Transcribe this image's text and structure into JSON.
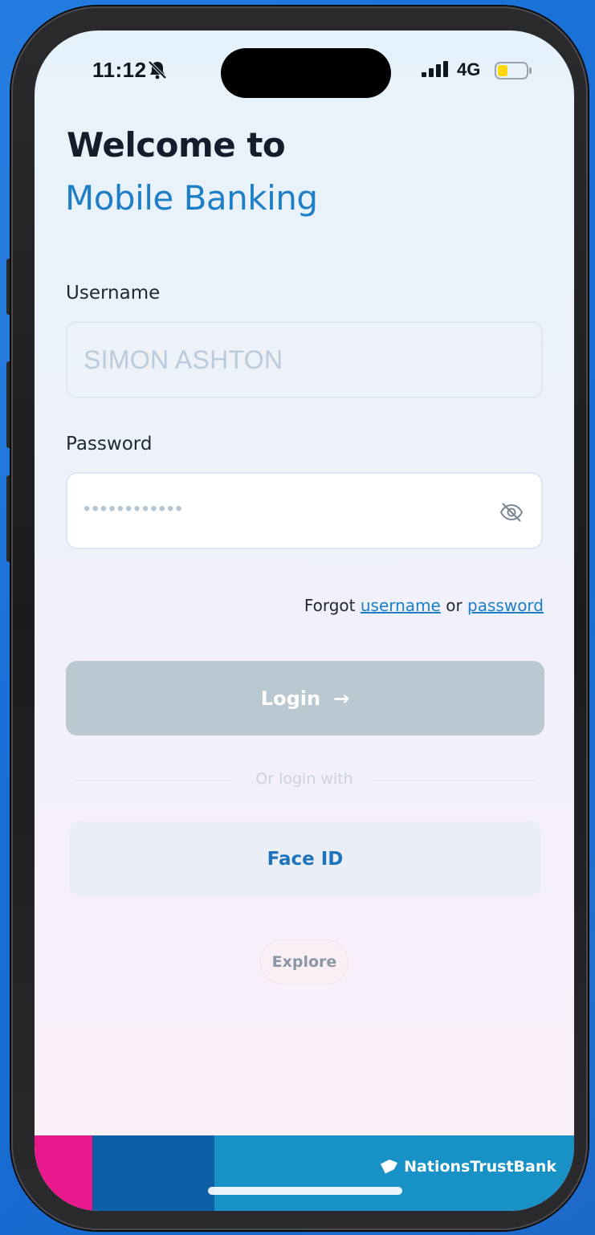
{
  "status_bar": {
    "time": "11:12",
    "network": "4G",
    "battery_color": "#ffd60a"
  },
  "header": {
    "welcome_text": "Welcome to",
    "app_name": "Mobile Banking"
  },
  "form": {
    "username_label": "Username",
    "username_value": "SIMON ASHTON",
    "password_label": "Password",
    "password_masked": "••••••••••••",
    "forgot_prefix": "Forgot",
    "forgot_username": "username",
    "forgot_or": "or",
    "forgot_password": "password"
  },
  "actions": {
    "login_label": "Login",
    "login_arrow": "→",
    "divider_text": "Or login with",
    "face_id_label": "Face ID",
    "explore_label": "Explore"
  },
  "brand": {
    "bank_name": "NationsTrustBank",
    "colors": {
      "accent_blue": "#1e7fc6",
      "pink": "#e8188d",
      "dark_blue": "#0f5fa6",
      "light_blue": "#1891c7",
      "login_disabled": "#b9c8d1"
    }
  },
  "icons": [
    "bell-slash-icon",
    "signal-icon",
    "battery-icon",
    "eye-off-icon",
    "arrow-right-icon",
    "bank-logo-icon"
  ]
}
